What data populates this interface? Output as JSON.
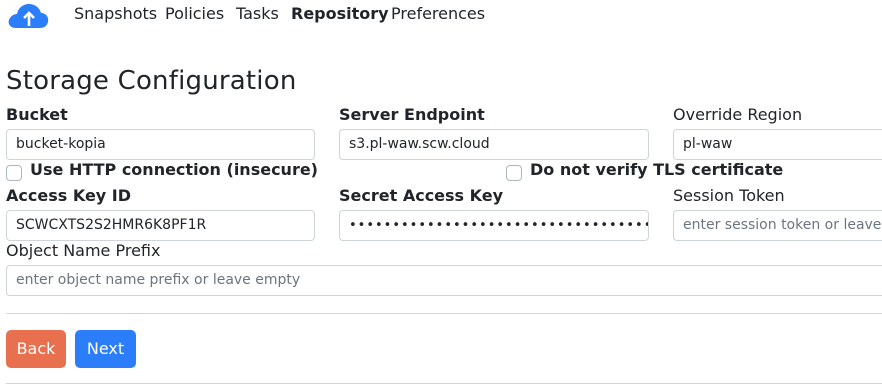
{
  "nav": {
    "items": [
      {
        "label": "Snapshots"
      },
      {
        "label": "Policies"
      },
      {
        "label": "Tasks"
      },
      {
        "label": "Repository",
        "active": true
      },
      {
        "label": "Preferences"
      }
    ],
    "logo_icon": "cloud-upload-icon"
  },
  "page": {
    "title": "Storage Configuration"
  },
  "form": {
    "bucket": {
      "label": "Bucket",
      "value": "bucket-kopia"
    },
    "server_endpoint": {
      "label": "Server Endpoint",
      "value": "s3.pl-waw.scw.cloud"
    },
    "override_region": {
      "label": "Override Region",
      "value": "pl-waw"
    },
    "use_http": {
      "label": "Use HTTP connection (insecure)",
      "checked": false
    },
    "no_verify_tls": {
      "label": "Do not verify TLS certificate",
      "checked": false
    },
    "access_key_id": {
      "label": "Access Key ID",
      "value": "SCWCXTS2S2HMR6K8PF1R"
    },
    "secret_access_key": {
      "label": "Secret Access Key",
      "value": "••••••••••••••••••••••••••••••••••••"
    },
    "session_token": {
      "label": "Session Token",
      "placeholder": "enter session token or leave empty"
    },
    "object_name_prefix": {
      "label": "Object Name Prefix",
      "placeholder": "enter object name prefix or leave empty"
    }
  },
  "buttons": {
    "back": {
      "label": "Back",
      "color": "#e8704e"
    },
    "next": {
      "label": "Next",
      "color": "#2b7dfa"
    }
  },
  "colors": {
    "brand": "#2b7dfa",
    "back": "#e8704e"
  }
}
